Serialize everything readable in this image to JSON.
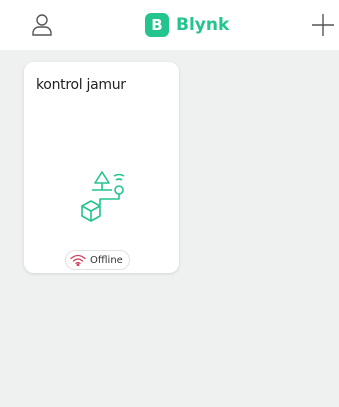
{
  "header": {
    "logo_letter": "B",
    "logo_text": "Blynk",
    "profile_icon": "user-icon",
    "add_icon": "plus-icon"
  },
  "colors": {
    "brand": "#23c48e",
    "offline": "#d3435c",
    "background": "#eff1f1"
  },
  "devices": [
    {
      "name": "kontrol jamur",
      "status": "Offline",
      "status_icon": "wifi-off-icon",
      "illustration": "device-template-icon"
    }
  ]
}
